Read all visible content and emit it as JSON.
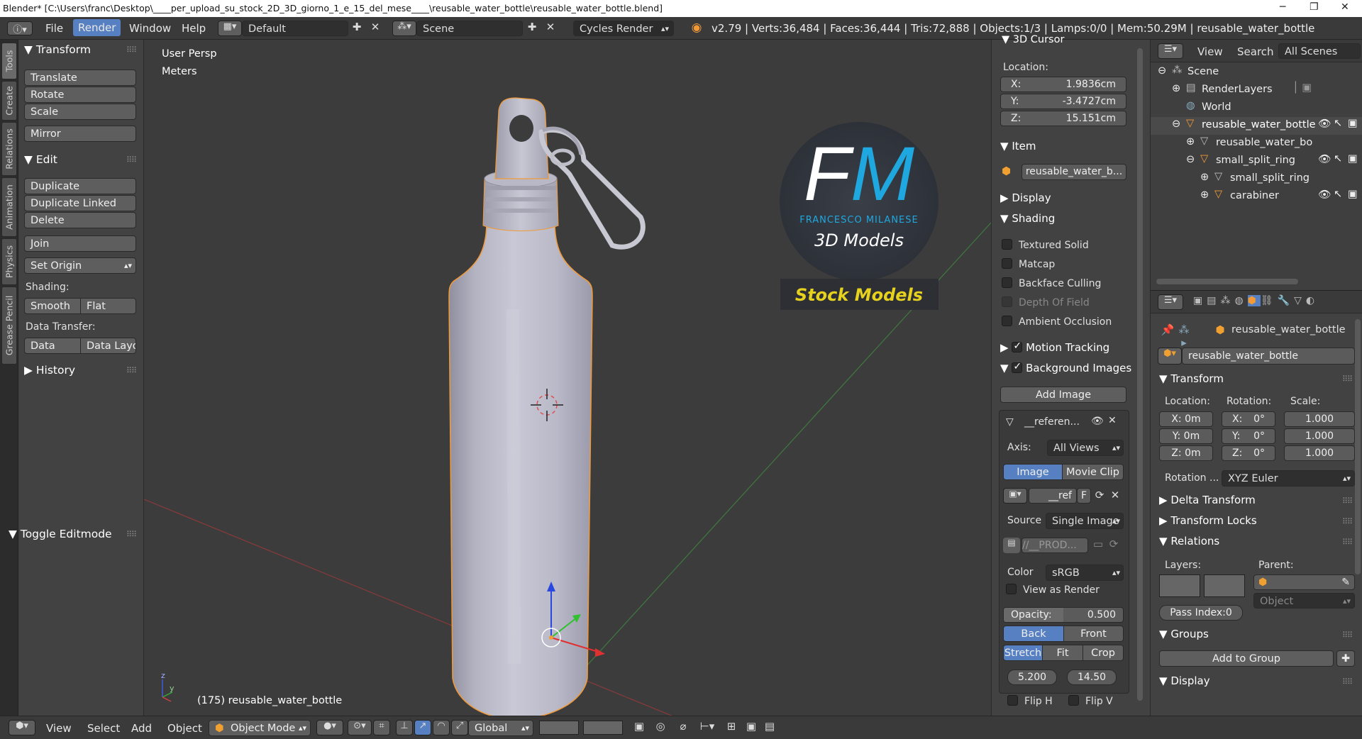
{
  "window": {
    "title": "Blender* [C:\\Users\\franc\\Desktop\\____per_upload_su_stock_2D_3D_giorno_1_e_15_del_mese____\\reusable_water_bottle\\reusable_water_bottle.blend]",
    "minimize": "─",
    "maximize": "❐",
    "close": "✕"
  },
  "header": {
    "menus": [
      "File",
      "Render",
      "Window",
      "Help"
    ],
    "layout": "Default",
    "scene": "Scene",
    "engine": "Cycles Render",
    "info": "v2.79 | Verts:36,484 | Faces:36,444 | Tris:72,888 | Objects:1/3 | Lamps:0/0 | Mem:50.29M | reusable_water_bottle"
  },
  "tool_tabs": [
    "Tools",
    "Create",
    "Relations",
    "Animation",
    "Physics",
    "Grease Pencil"
  ],
  "toolshelf": {
    "transform_title": "Transform",
    "translate": "Translate",
    "rotate": "Rotate",
    "scale": "Scale",
    "mirror": "Mirror",
    "edit_title": "Edit",
    "duplicate": "Duplicate",
    "duplicate_linked": "Duplicate Linked",
    "delete": "Delete",
    "join": "Join",
    "set_origin": "Set Origin",
    "shading_label": "Shading:",
    "smooth": "Smooth",
    "flat": "Flat",
    "data_transfer_label": "Data Transfer:",
    "data": "Data",
    "data_layout": "Data Layo",
    "history_title": "History",
    "toggle_editmode": "Toggle Editmode"
  },
  "viewport": {
    "view_name": "User Persp",
    "units": "Meters",
    "object_label": "(175) reusable_water_bottle",
    "logo_initials": "FM",
    "logo_name": "FRANCESCO MILANESE",
    "logo_sub": "3D Models",
    "banner": "Stock Models"
  },
  "npanel": {
    "cursor_title": "3D Cursor",
    "location_label": "Location:",
    "x": "X:",
    "x_val": "1.9836cm",
    "y": "Y:",
    "y_val": "-3.4727cm",
    "z": "Z:",
    "z_val": "15.151cm",
    "item_title": "Item",
    "item_name": "reusable_water_b...",
    "display_title": "Display",
    "shading_title": "Shading",
    "textured_solid": "Textured Solid",
    "matcap": "Matcap",
    "backface_culling": "Backface Culling",
    "depth_of_field": "Depth Of Field",
    "ambient_occlusion": "Ambient Occlusion",
    "motion_tracking": "Motion Tracking",
    "background_images": "Background Images",
    "add_image": "Add Image",
    "ref_name": "__referen...",
    "axis_label": "Axis:",
    "axis_value": "All Views",
    "image_tab": "Image",
    "movie_clip_tab": "Movie Clip",
    "ref_file": "__ref",
    "ref_f": "F",
    "source_label": "Source",
    "source_value": "Single Image",
    "path_value": "//__PROD...",
    "color_label": "Color",
    "color_value": "sRGB",
    "view_as_render": "View as Render",
    "opacity_label": "Opacity:",
    "opacity_value": "0.500",
    "opacity_fraction": 0.5,
    "back": "Back",
    "front": "Front",
    "stretch": "Stretch",
    "fit": "Fit",
    "crop": "Crop",
    "size_a": "5.200",
    "size_b": "14.50",
    "flip_h": "Flip H",
    "flip_v": "Flip V"
  },
  "outliner": {
    "view": "View",
    "search": "Search",
    "all_scenes": "All Scenes",
    "rows": [
      {
        "label": "Scene"
      },
      {
        "label": "RenderLayers"
      },
      {
        "label": "World"
      },
      {
        "label": "reusable_water_bottle"
      },
      {
        "label": "reusable_water_bo"
      },
      {
        "label": "small_split_ring"
      },
      {
        "label": "small_split_ring"
      },
      {
        "label": "carabiner"
      }
    ]
  },
  "properties": {
    "object_path": "reusable_water_bottle",
    "object_name": "reusable_water_bottle",
    "transform_title": "Transform",
    "location_label": "Location:",
    "rotation_label": "Rotation:",
    "scale_label": "Scale:",
    "loc_x": "X: 0m",
    "loc_y": "Y: 0m",
    "loc_z": "Z: 0m",
    "rot_x": "X:",
    "rot_x_val": "0°",
    "rot_y": "Y:",
    "rot_y_val": "0°",
    "rot_z": "Z:",
    "rot_z_val": "0°",
    "scale_x": "1.000",
    "scale_y": "1.000",
    "scale_z": "1.000",
    "rotation_mode_label": "Rotation ...",
    "rotation_mode": "XYZ Euler",
    "delta_transform": "Delta Transform",
    "transform_locks": "Transform Locks",
    "relations": "Relations",
    "layers_label": "Layers:",
    "parent_label": "Parent:",
    "parent_type": "Object",
    "pass_index": "Pass Index:0",
    "groups": "Groups",
    "add_to_group": "Add to Group",
    "display": "Display"
  },
  "bottom": {
    "view": "View",
    "select": "Select",
    "add": "Add",
    "object": "Object",
    "mode": "Object Mode",
    "orientation": "Global"
  },
  "colors": {
    "accent": "#5680c2",
    "selection_orange": "#f29a38",
    "logo_blue": "#1fa8e0",
    "banner_yellow": "#e6d21e"
  }
}
